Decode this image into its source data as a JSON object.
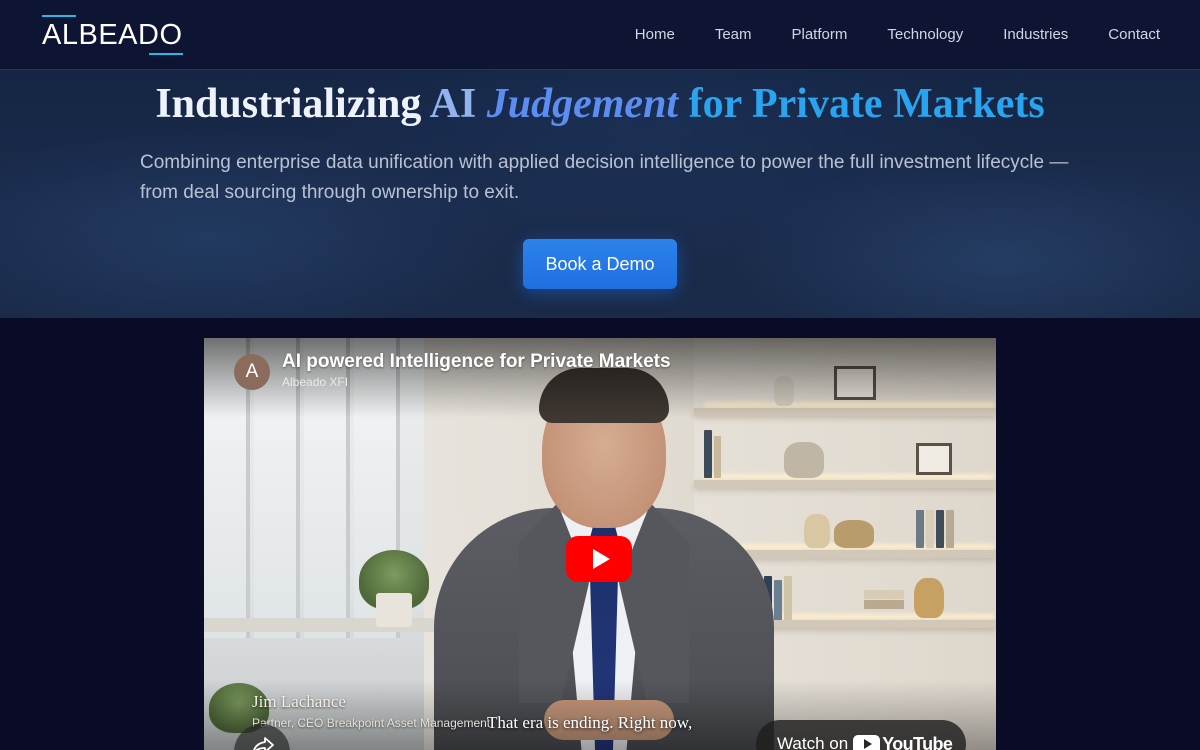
{
  "brand": {
    "logo_text": "ALBEADO",
    "accent_color": "#2bb6ea"
  },
  "nav": {
    "items": [
      {
        "label": "Home"
      },
      {
        "label": "Team"
      },
      {
        "label": "Platform"
      },
      {
        "label": "Technology"
      },
      {
        "label": "Industries"
      },
      {
        "label": "Contact"
      }
    ]
  },
  "hero": {
    "title_part1": "Industrializing",
    "title_part2": "AI",
    "title_part3": "Judgement",
    "title_part4": "for Private Markets",
    "subtitle": "Combining enterprise data unification with applied decision intelligence to power the full investment lifecycle — from deal sourcing through ownership to exit.",
    "cta_label": "Book a Demo",
    "cta_color": "#1e6fe0"
  },
  "video": {
    "title": "AI powered Intelligence for Private Markets",
    "channel_name": "Albeado XFI",
    "channel_initial": "A",
    "speaker_name": "Jim Lachance",
    "speaker_role": "Partner, CEO Breakpoint Asset Management",
    "caption": "That era is ending. Right now,",
    "watch_on_label": "Watch on",
    "youtube_label": "YouTube",
    "play_color": "#ff0000"
  }
}
